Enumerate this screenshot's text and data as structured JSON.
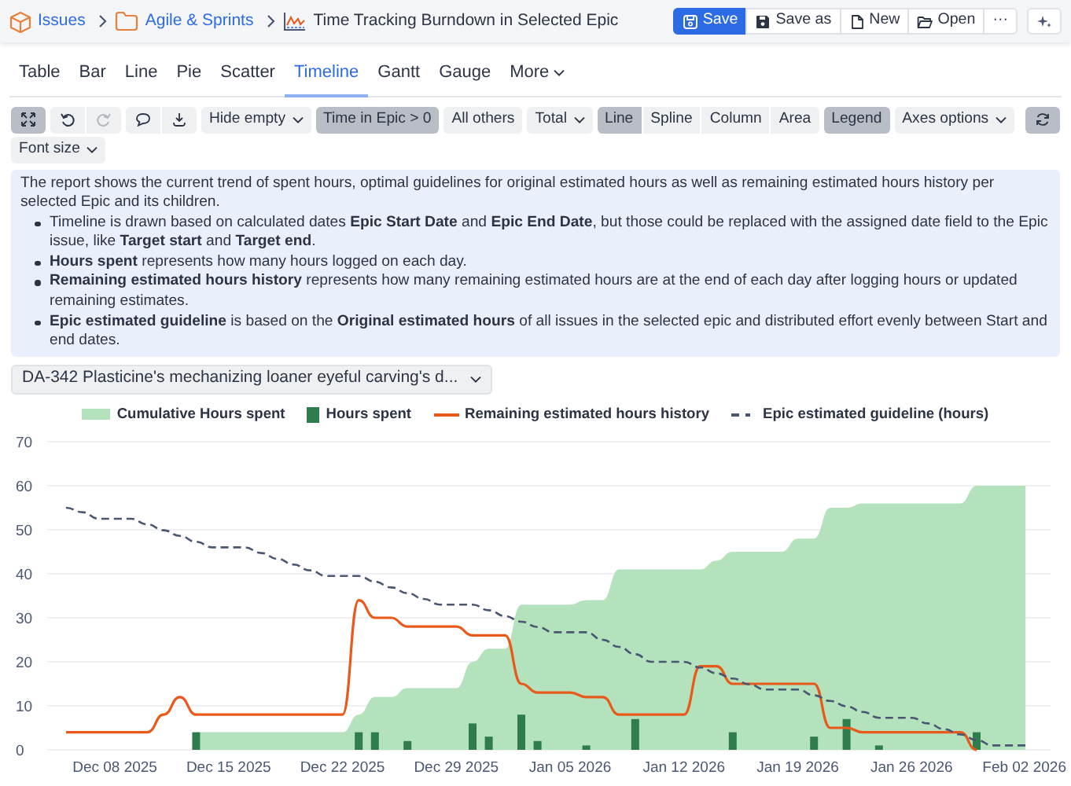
{
  "breadcrumb": [
    {
      "label": "Issues",
      "link": true
    },
    {
      "label": "Agile & Sprints",
      "link": true
    },
    {
      "label": "Time Tracking Burndown in Selected Epic",
      "link": false
    }
  ],
  "header_buttons": [
    {
      "label": "Save",
      "primary": true
    },
    {
      "label": "Save as",
      "primary": false
    },
    {
      "label": "New",
      "primary": false
    },
    {
      "label": "Open",
      "primary": false
    },
    {
      "label": "···",
      "primary": false
    }
  ],
  "tabs": [
    {
      "label": "Table",
      "selected": false,
      "dropdown": false
    },
    {
      "label": "Bar",
      "selected": false,
      "dropdown": false
    },
    {
      "label": "Line",
      "selected": false,
      "dropdown": false
    },
    {
      "label": "Pie",
      "selected": false,
      "dropdown": false
    },
    {
      "label": "Scatter",
      "selected": false,
      "dropdown": false
    },
    {
      "label": "Timeline",
      "selected": true,
      "dropdown": false
    },
    {
      "label": "Gantt",
      "selected": false,
      "dropdown": false
    },
    {
      "label": "Gauge",
      "selected": false,
      "dropdown": false
    },
    {
      "label": "More",
      "selected": false,
      "dropdown": true
    }
  ],
  "toolbar": {
    "fullscreen_active": true,
    "undo_disabled": false,
    "redo_disabled": true,
    "refresh_active": true,
    "filters": [
      {
        "label": "Hide empty",
        "dropdown": true,
        "active": false
      },
      {
        "label": "Time in Epic > 0",
        "dropdown": false,
        "active": true
      },
      {
        "label": "All others",
        "dropdown": false,
        "active": false
      },
      {
        "label": "Total",
        "dropdown": true,
        "active": false
      }
    ],
    "chart_styles": [
      {
        "label": "Line",
        "selected": true
      },
      {
        "label": "Spline",
        "selected": false
      },
      {
        "label": "Column",
        "selected": false
      },
      {
        "label": "Area",
        "selected": false
      }
    ],
    "legend": {
      "label": "Legend",
      "active": true
    },
    "axes": {
      "label": "Axes options",
      "dropdown": true
    },
    "font_size": {
      "label": "Font size",
      "dropdown": true
    }
  },
  "info": {
    "intro": "The report shows the current trend of spent hours, optimal guidelines for original estimated hours as well as remaining estimated hours history per selected Epic and its children.",
    "bullets": [
      "Timeline is drawn based on calculated dates **Epic Start Date** and **Epic End Date**, but those could be replaced with the assigned date field to the Epic issue, like **Target start** and **Target end**.",
      "**Hours spent** represents how many hours logged on each day.",
      "**Remaining estimated hours history** represents how many remaining estimated hours are at the end of each day after logging hours or updated remaining estimates.",
      "**Epic estimated guideline** is based on the **Original estimated hours** of all issues in the selected epic and distributed effort evenly between Start and end dates."
    ]
  },
  "epic_select": {
    "value": "DA-342 Plasticine's mechanizing loaner eyeful carving's d..."
  },
  "chart_data": {
    "type": "area",
    "categories": [
      null,
      null,
      null,
      "Dec 08 2025",
      null,
      null,
      null,
      null,
      null,
      null,
      "Dec 15 2025",
      null,
      null,
      null,
      null,
      null,
      null,
      "Dec 22 2025",
      null,
      null,
      null,
      null,
      null,
      null,
      "Dec 29 2025",
      null,
      null,
      null,
      null,
      null,
      null,
      "Jan 05 2026",
      null,
      null,
      null,
      null,
      null,
      null,
      "Jan 12 2026",
      null,
      null,
      null,
      null,
      null,
      null,
      "Jan 19 2026",
      null,
      null,
      null,
      null,
      null,
      null,
      "Jan 26 2026",
      null,
      null,
      null,
      null,
      null,
      null,
      "Feb 02 2026"
    ],
    "ylim": [
      0,
      70
    ],
    "grid": true,
    "yticks": [
      {
        "value": 0,
        "label": "0"
      },
      {
        "value": 10,
        "label": "10"
      },
      {
        "value": 20,
        "label": "20"
      },
      {
        "value": 30,
        "label": "30"
      },
      {
        "value": 40,
        "label": "40"
      },
      {
        "value": 50,
        "label": "50"
      },
      {
        "value": 60,
        "label": "60"
      },
      {
        "value": 70,
        "label": "70"
      }
    ],
    "series": [
      {
        "name": "Cumulative Hours spent",
        "color": "#b3e2bd",
        "values": [
          null,
          null,
          null,
          null,
          null,
          null,
          null,
          null,
          4,
          4,
          4,
          4,
          4,
          4,
          4,
          4,
          4,
          4,
          8,
          12,
          12,
          14,
          14,
          14,
          14,
          20,
          23,
          23,
          33,
          33,
          33,
          33,
          34,
          34,
          41,
          41,
          41,
          41,
          41,
          41,
          43,
          45,
          45,
          45,
          45,
          48,
          48,
          55,
          55,
          56,
          56,
          56,
          56,
          56,
          56,
          56,
          60,
          60,
          60,
          60
        ]
      },
      {
        "name": "Hours spent",
        "type": "bar",
        "color": "#2f7d4c",
        "values": [
          null,
          null,
          null,
          null,
          null,
          null,
          null,
          null,
          4,
          null,
          null,
          null,
          null,
          null,
          null,
          null,
          null,
          null,
          4,
          4,
          null,
          2,
          null,
          null,
          null,
          6,
          3,
          null,
          8,
          2,
          null,
          null,
          1,
          null,
          null,
          7,
          null,
          null,
          null,
          null,
          null,
          4,
          null,
          null,
          null,
          null,
          3,
          null,
          7,
          null,
          1,
          null,
          null,
          null,
          null,
          null,
          4,
          null,
          null,
          null
        ]
      },
      {
        "name": "Remaining estimated hours history",
        "type": "line",
        "color": "#e8591a",
        "values": [
          4,
          4,
          4,
          4,
          4,
          4,
          8,
          12,
          8,
          8,
          8,
          8,
          8,
          8,
          8,
          8,
          8,
          8,
          34,
          30,
          30,
          28,
          28,
          28,
          28,
          26,
          26,
          26,
          15,
          13,
          13,
          13,
          12,
          12,
          8,
          8,
          8,
          8,
          8,
          19,
          19,
          15,
          15,
          15,
          15,
          15,
          15,
          5,
          5,
          4,
          4,
          4,
          4,
          4,
          4,
          4,
          0,
          null,
          null,
          null
        ]
      },
      {
        "name": "Epic estimated guideline (hours)",
        "type": "line",
        "line_style": "dashed",
        "color": "#4a5672",
        "values": [
          55,
          54,
          52.5,
          52.5,
          52.5,
          51.2,
          49.9,
          48.6,
          47.3,
          46,
          46,
          46,
          44.7,
          43.4,
          42.1,
          40.8,
          39.5,
          39.5,
          39.5,
          38.2,
          36.9,
          35.6,
          34.3,
          33,
          33,
          33,
          31.7,
          30.4,
          29.1,
          27.9,
          26.7,
          26.7,
          26.7,
          25,
          23.4,
          21.7,
          20,
          20,
          20,
          18.7,
          17.4,
          16.2,
          14.9,
          13.7,
          13.7,
          13.7,
          12.4,
          11.1,
          9.9,
          8.6,
          7.3,
          7.3,
          7.3,
          6,
          4.7,
          3.5,
          2.2,
          1,
          1,
          1
        ]
      }
    ]
  }
}
